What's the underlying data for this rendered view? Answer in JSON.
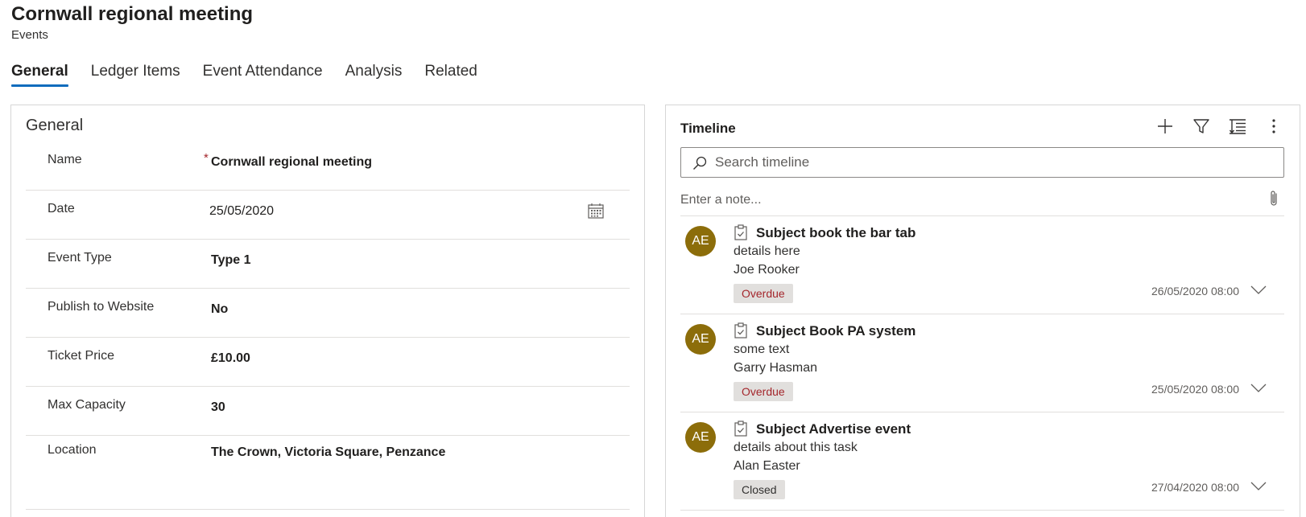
{
  "header": {
    "title": "Cornwall regional meeting",
    "subtitle": "Events"
  },
  "tabs": [
    {
      "label": "General",
      "active": true
    },
    {
      "label": "Ledger Items"
    },
    {
      "label": "Event Attendance"
    },
    {
      "label": "Analysis"
    },
    {
      "label": "Related"
    }
  ],
  "general": {
    "section_title": "General",
    "fields": [
      {
        "label": "Name",
        "required": "*",
        "value": "Cornwall regional meeting"
      },
      {
        "label": "Date",
        "value": "25/05/2020"
      },
      {
        "label": "Event Type",
        "value": "Type 1"
      },
      {
        "label": "Publish to Website",
        "value": "No"
      },
      {
        "label": "Ticket Price",
        "value": "£10.00"
      },
      {
        "label": "Max Capacity",
        "value": "30"
      },
      {
        "label": "Location",
        "value": "The Crown, Victoria Square, Penzance"
      }
    ]
  },
  "timeline": {
    "title": "Timeline",
    "search_placeholder": "Search timeline",
    "note_placeholder": "Enter a note...",
    "actions": [
      "add-icon",
      "filter-icon",
      "sort-icon",
      "more-icon"
    ],
    "items": [
      {
        "avatar": "AE",
        "subject": "Subject book the bar tab",
        "details": "details here",
        "owner": "Joe Rooker",
        "status": "Overdue",
        "date": "26/05/2020 08:00"
      },
      {
        "avatar": "AE",
        "subject": "Subject Book PA system",
        "details": "some text",
        "owner": "Garry Hasman",
        "status": "Overdue",
        "date": "25/05/2020 08:00"
      },
      {
        "avatar": "AE",
        "subject": "Subject Advertise event",
        "details": "details about this task",
        "owner": "Alan Easter",
        "status": "Closed",
        "date": "27/04/2020 08:00"
      }
    ]
  },
  "colors": {
    "accent": "#0f6cbd",
    "avatar_bg": "#8c6d0a",
    "overdue": "#a4262c",
    "required": "#a4262c",
    "badge_bg": "#e1dfdd"
  }
}
